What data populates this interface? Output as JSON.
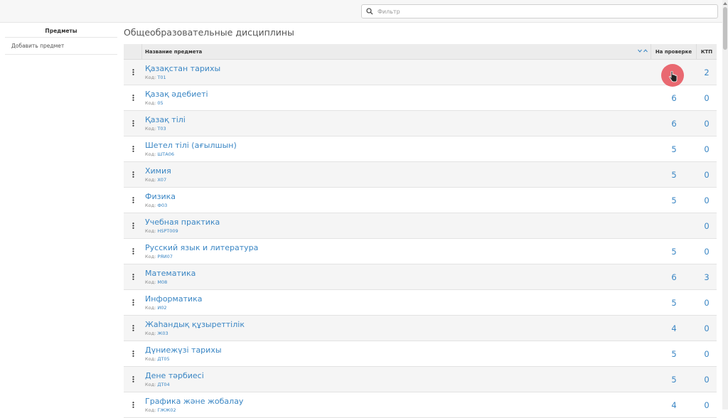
{
  "filter": {
    "placeholder": "Фильтр"
  },
  "sidebar": {
    "title": "Предметы",
    "items": [
      {
        "label": "Добавить предмет"
      }
    ]
  },
  "page_title": "Общеобразовательные дисциплины",
  "table": {
    "headers": {
      "name": "Название предмета",
      "review": "На проверке",
      "ktp": "КТП"
    },
    "code_label": "Код:",
    "rows": [
      {
        "name": "Қазақстан тарихы",
        "code": "Т01",
        "review": "",
        "ktp": "2"
      },
      {
        "name": "Қазақ әдебиеті",
        "code": "05",
        "review": "6",
        "ktp": "0"
      },
      {
        "name": "Қазақ тілі",
        "code": "Т03",
        "review": "6",
        "ktp": "0"
      },
      {
        "name": "Шетел тілі (ағылшын)",
        "code": "ШТА06",
        "review": "5",
        "ktp": "0"
      },
      {
        "name": "Химия",
        "code": "Х07",
        "review": "5",
        "ktp": "0"
      },
      {
        "name": "Физика",
        "code": "Ф03",
        "review": "5",
        "ktp": "0"
      },
      {
        "name": "Учебная практика",
        "code": "HSPT009",
        "review": "",
        "ktp": "0"
      },
      {
        "name": "Русский язык и литература",
        "code": "РЯИ07",
        "review": "5",
        "ktp": "0"
      },
      {
        "name": "Математика",
        "code": "М08",
        "review": "6",
        "ktp": "3"
      },
      {
        "name": "Информатика",
        "code": "И02",
        "review": "5",
        "ktp": "0"
      },
      {
        "name": "Жаһандық құзыреттілік",
        "code": "Ж03",
        "review": "4",
        "ktp": "0"
      },
      {
        "name": "Дүниежүзі тарихы",
        "code": "ДТ05",
        "review": "5",
        "ktp": "0"
      },
      {
        "name": "Дене тәрбиесі",
        "code": "ДТ04",
        "review": "5",
        "ktp": "0"
      },
      {
        "name": "Графика және жобалау",
        "code": "ГЖЖ02",
        "review": "4",
        "ktp": "0"
      }
    ]
  },
  "colors": {
    "link": "#3a86c4",
    "cursor_highlight": "#e64650"
  }
}
